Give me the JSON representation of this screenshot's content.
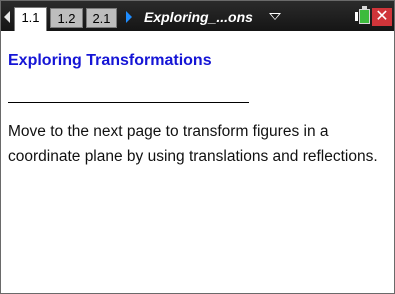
{
  "topbar": {
    "tabs": [
      {
        "label": "1.1",
        "active": true
      },
      {
        "label": "1.2",
        "active": false
      },
      {
        "label": "2.1",
        "active": false
      }
    ],
    "document_title": "Exploring_...ons",
    "close_label": "✕",
    "colors": {
      "bar": "#1b1b1b",
      "arrow": "#1e8cff",
      "battery": "#3dbb3d",
      "close": "#d0353a"
    }
  },
  "page": {
    "heading": "Exploring Transformations",
    "body": "Move to the next page to transform figures in a coordinate plane by using translations and reflections.",
    "heading_color": "#1515d6"
  }
}
